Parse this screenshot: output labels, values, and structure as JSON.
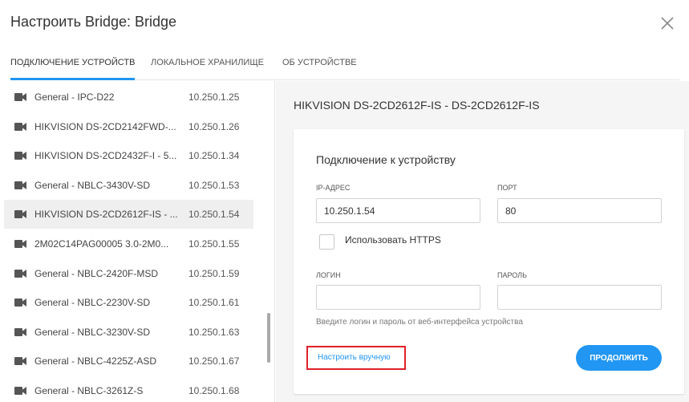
{
  "dialog": {
    "title": "Настроить Bridge: Bridge"
  },
  "tabs": [
    {
      "label": "Подключение устройств",
      "active": true
    },
    {
      "label": "Локальное хранилище",
      "active": false
    },
    {
      "label": "Об устройстве",
      "active": false
    }
  ],
  "devices": [
    {
      "name": "General - IPC-D22",
      "ip": "10.250.1.25",
      "selected": false
    },
    {
      "name": "HIKVISION DS-2CD2142FWD-...",
      "ip": "10.250.1.26",
      "selected": false
    },
    {
      "name": "HIKVISION DS-2CD2432F-I - 5...",
      "ip": "10.250.1.34",
      "selected": false
    },
    {
      "name": "General - NBLC-3430V-SD",
      "ip": "10.250.1.53",
      "selected": false
    },
    {
      "name": "HIKVISION DS-2CD2612F-IS - ...",
      "ip": "10.250.1.54",
      "selected": true
    },
    {
      "name": "2M02C14PAG00005 3.0-2M0...",
      "ip": "10.250.1.55",
      "selected": false
    },
    {
      "name": "General - NBLC-2420F-MSD",
      "ip": "10.250.1.59",
      "selected": false
    },
    {
      "name": "General - NBLC-2230V-SD",
      "ip": "10.250.1.61",
      "selected": false
    },
    {
      "name": "General - NBLC-3230V-SD",
      "ip": "10.250.1.63",
      "selected": false
    },
    {
      "name": "General - NBLC-4225Z-ASD",
      "ip": "10.250.1.67",
      "selected": false
    },
    {
      "name": "General - NBLC-3261Z-S",
      "ip": "10.250.1.68",
      "selected": false
    }
  ],
  "detail": {
    "device_title": "HIKVISION DS-2CD2612F-IS - DS-2CD2612F-IS",
    "card_title": "Подключение к устройству",
    "ip_label": "IP-адрес",
    "ip_value": "10.250.1.54",
    "port_label": "Порт",
    "port_value": "80",
    "https_label": "Использовать HTTPS",
    "https_checked": false,
    "login_label": "Логин",
    "login_value": "",
    "password_label": "Пароль",
    "password_value": "",
    "hint": "Введите логин и пароль от веб-интерфейса устройства",
    "manual_link": "Настроить вручную",
    "continue_label": "Продолжить"
  },
  "icons": {
    "close": "close-icon",
    "device": "camera-icon"
  },
  "colors": {
    "accent": "#2196f3",
    "highlight_border": "#e0202a",
    "selected_row": "#efefef",
    "panel_bg": "#f5f5f5"
  }
}
